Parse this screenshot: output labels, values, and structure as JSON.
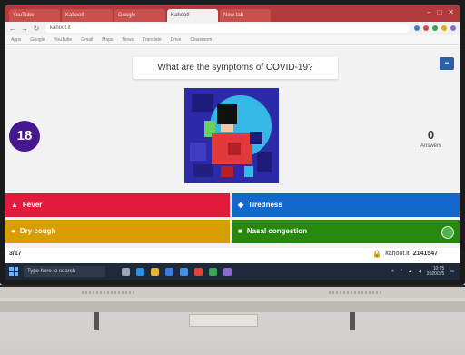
{
  "browser": {
    "tabs": [
      {
        "label": "YouTube",
        "active": false
      },
      {
        "label": "Kahoot!",
        "active": false
      },
      {
        "label": "Google",
        "active": false
      },
      {
        "label": "Kahoot!",
        "active": true
      },
      {
        "label": "New tab",
        "active": false
      }
    ],
    "window_controls": [
      "–",
      "□",
      "✕"
    ],
    "address": "kahoot.it",
    "bookmarks": [
      "Apps",
      "Google",
      "YouTube",
      "Gmail",
      "Maps",
      "News",
      "Translate",
      "Drive",
      "Classroom"
    ]
  },
  "quiz": {
    "question": "What are the symptoms of COVID-19?",
    "timer": "18",
    "answers_count": "0",
    "answers_label": "Answers",
    "answers": [
      {
        "label": "Fever",
        "color": "#e21b3c",
        "shape": "▲"
      },
      {
        "label": "Tiredness",
        "color": "#1368ce",
        "shape": "◆"
      },
      {
        "label": "Dry cough",
        "color": "#d89e00",
        "shape": "●"
      },
      {
        "label": "Nasal congestion",
        "color": "#26890c",
        "shape": "■"
      }
    ],
    "progress": "3/17",
    "join_site": "kahoot.it",
    "game_pin": "2141547"
  },
  "taskbar": {
    "search_placeholder": "Type here to search",
    "clock_time": "10:25",
    "clock_date": "2020/3/5"
  },
  "colors": {
    "kahoot_purple": "#46178f",
    "answer_red": "#e21b3c",
    "answer_blue": "#1368ce",
    "answer_yellow": "#d89e00",
    "answer_green": "#26890c",
    "tab_bar": "#b23a3a",
    "taskbar": "#1e2a3a"
  }
}
